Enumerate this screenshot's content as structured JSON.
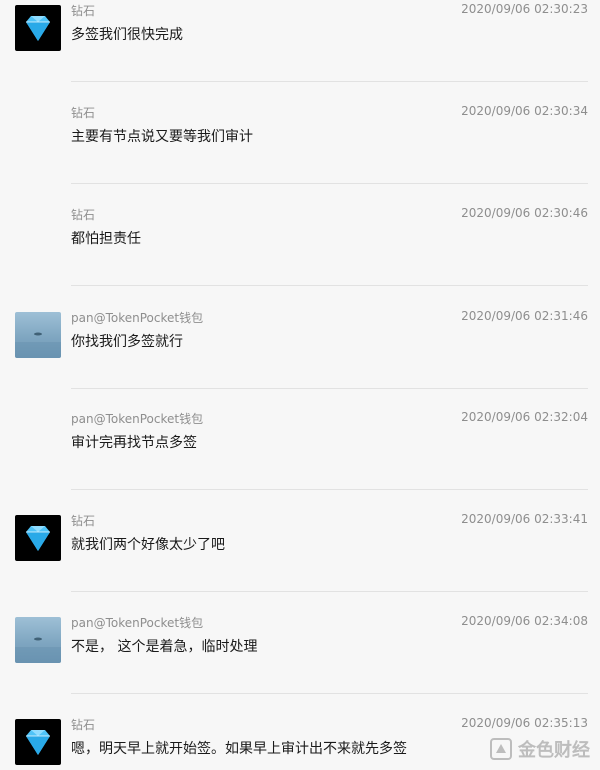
{
  "messages": [
    {
      "sender": "钻石",
      "time": "2020/09/06 02:30:23",
      "text": "多签我们很快完成",
      "avatar": "diamond"
    },
    {
      "sender": "钻石",
      "time": "2020/09/06 02:30:34",
      "text": "主要有节点说又要等我们审计",
      "avatar": ""
    },
    {
      "sender": "钻石",
      "time": "2020/09/06 02:30:46",
      "text": "都怕担责任",
      "avatar": ""
    },
    {
      "sender": "pan@TokenPocket钱包",
      "time": "2020/09/06 02:31:46",
      "text": "你找我们多签就行",
      "avatar": "water"
    },
    {
      "sender": "pan@TokenPocket钱包",
      "time": "2020/09/06 02:32:04",
      "text": "审计完再找节点多签",
      "avatar": ""
    },
    {
      "sender": "钻石",
      "time": "2020/09/06 02:33:41",
      "text": "就我们两个好像太少了吧",
      "avatar": "diamond"
    },
    {
      "sender": "pan@TokenPocket钱包",
      "time": "2020/09/06 02:34:08",
      "text": "不是， 这个是着急，临时处理",
      "avatar": "water"
    },
    {
      "sender": "钻石",
      "time": "2020/09/06 02:35:13",
      "text": "嗯，明天早上就开始签。如果早上审计出不来就先多签",
      "avatar": "diamond"
    }
  ],
  "watermark": {
    "text": "金色财经"
  },
  "colors": {
    "background": "#f7f7f7",
    "meta_text": "#8e8e8e",
    "message_text": "#1a1a1a",
    "diamond": "#4fc3f7"
  }
}
